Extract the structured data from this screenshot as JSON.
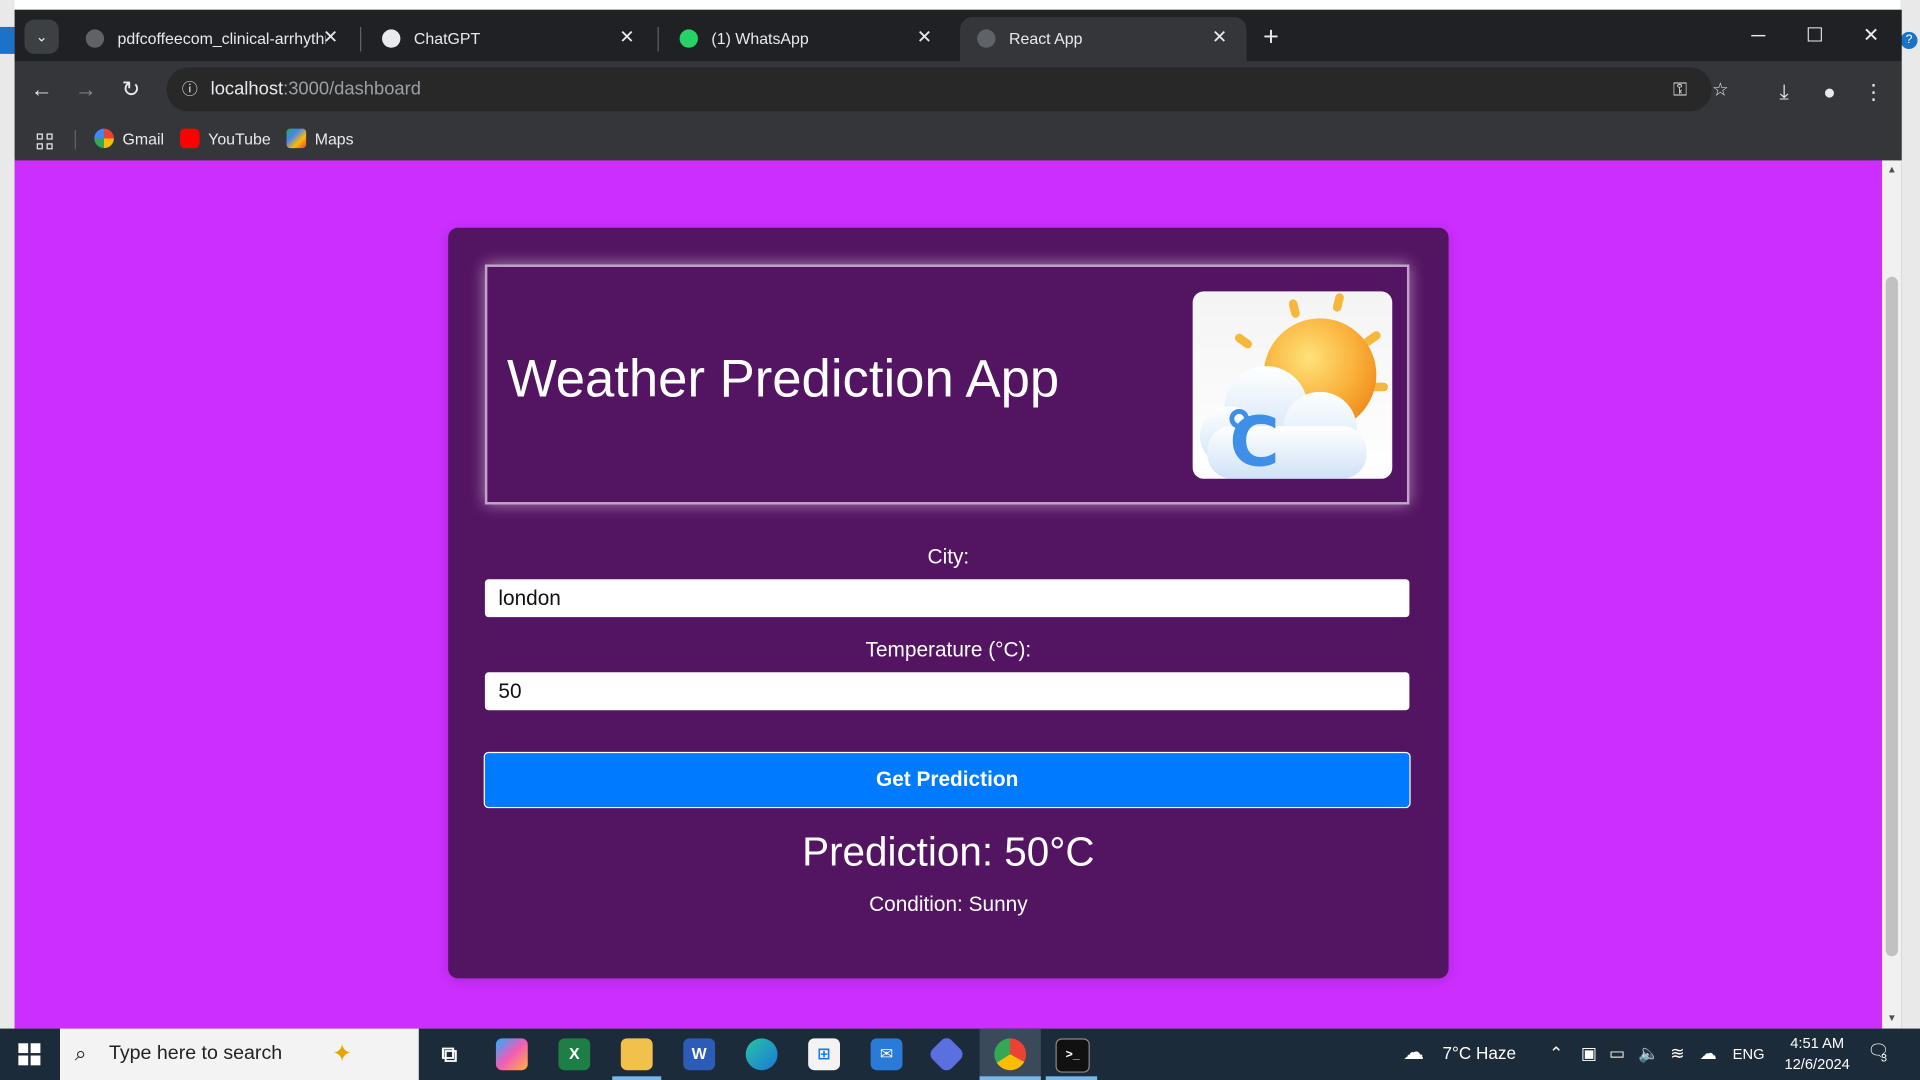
{
  "browser": {
    "tabs": [
      {
        "title": "pdfcoffeecom_clinical-arrhythm",
        "close": "✕"
      },
      {
        "title": "ChatGPT",
        "close": "✕"
      },
      {
        "title": "(1) WhatsApp",
        "close": "✕"
      },
      {
        "title": "React App",
        "close": "✕",
        "active": true
      }
    ],
    "new_tab": "+",
    "window_controls": {
      "minimize": "─",
      "maximize": "☐",
      "close": "✕"
    },
    "url_host": "localhost",
    "url_rest": ":3000/dashboard",
    "bookmarks": [
      {
        "label": "Gmail",
        "icon": "google-icon"
      },
      {
        "label": "YouTube",
        "icon": "youtube-icon"
      },
      {
        "label": "Maps",
        "icon": "maps-icon"
      }
    ]
  },
  "app": {
    "title": "Weather Prediction App",
    "city_label": "City:",
    "city_value": "london",
    "temperature_label": "Temperature (°C):",
    "temperature_value": "50",
    "button_label": "Get Prediction",
    "prediction": "Prediction: 50°C",
    "condition": "Condition: Sunny",
    "colors": {
      "page_background": "#cc2eff",
      "card_background": "#531562",
      "button": "#007bff"
    }
  },
  "taskbar": {
    "search_placeholder": "Type here to search",
    "weather": "7°C  Haze",
    "language": "ENG",
    "time": "4:51 AM",
    "date": "12/6/2024",
    "notification_count": "3"
  }
}
